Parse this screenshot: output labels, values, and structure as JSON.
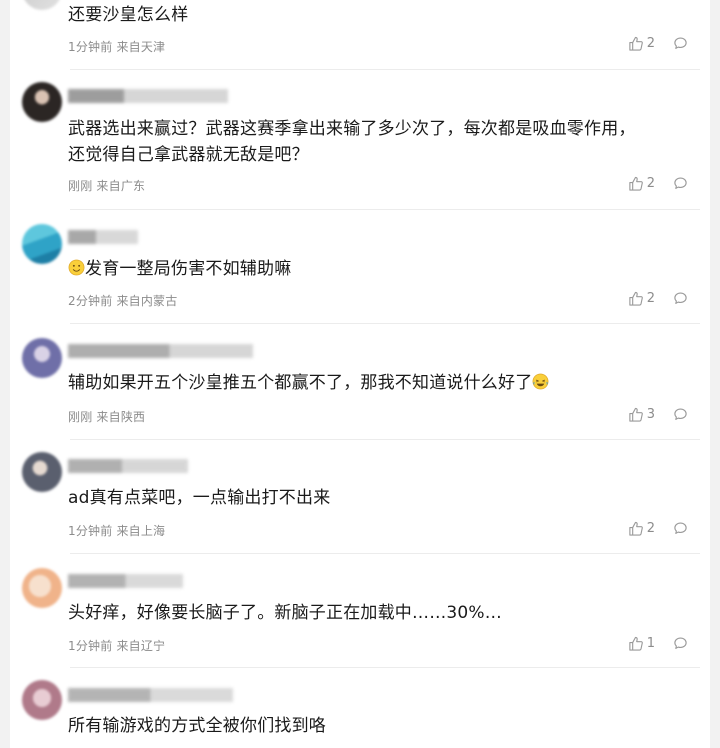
{
  "comments": [
    {
      "text": "还要沙皇怎么样",
      "meta": "1分钟前 来自天津",
      "likes": "2",
      "avatar_colors": [
        "#c9c9c9",
        "#e2e2e2"
      ]
    },
    {
      "text_line1": "武器选出来赢过？武器这赛季拿出来输了多少次了，每次都是吸血零作用，",
      "text_line2": "还觉得自己拿武器就无敌是吧？",
      "meta": "刚刚 来自广东",
      "likes": "2",
      "avatar_colors": [
        "#2b2624",
        "#d9c2b3"
      ]
    },
    {
      "text": "发育一整局伤害不如辅助嘛",
      "meta": "2分钟前 来自内蒙古",
      "likes": "2",
      "emoji": "slight-smile-emoji",
      "avatar_colors": [
        "#2fa3c7",
        "#5ec7dd"
      ]
    },
    {
      "text": "辅助如果开五个沙皇推五个都赢不了，那我不知道说什么好了",
      "meta": "刚刚 来自陕西",
      "likes": "3",
      "emoji": "laughing-tears-emoji",
      "avatar_colors": [
        "#6f6fa8",
        "#d9d2e6"
      ]
    },
    {
      "text": "ad真有点菜吧，一点输出打不出来",
      "meta": "1分钟前 来自上海",
      "likes": "2",
      "avatar_colors": [
        "#5a5f6e",
        "#e6dad1"
      ]
    },
    {
      "text": "头好痒，好像要长脑子了。新脑子正在加载中……30%…",
      "meta": "1分钟前 来自辽宁",
      "likes": "1",
      "avatar_colors": [
        "#f0b38a",
        "#f7e0cd"
      ]
    },
    {
      "text": "所有输游戏的方式全被你们找到咯",
      "avatar_colors": [
        "#b07a8a",
        "#e8ccd3"
      ]
    }
  ]
}
